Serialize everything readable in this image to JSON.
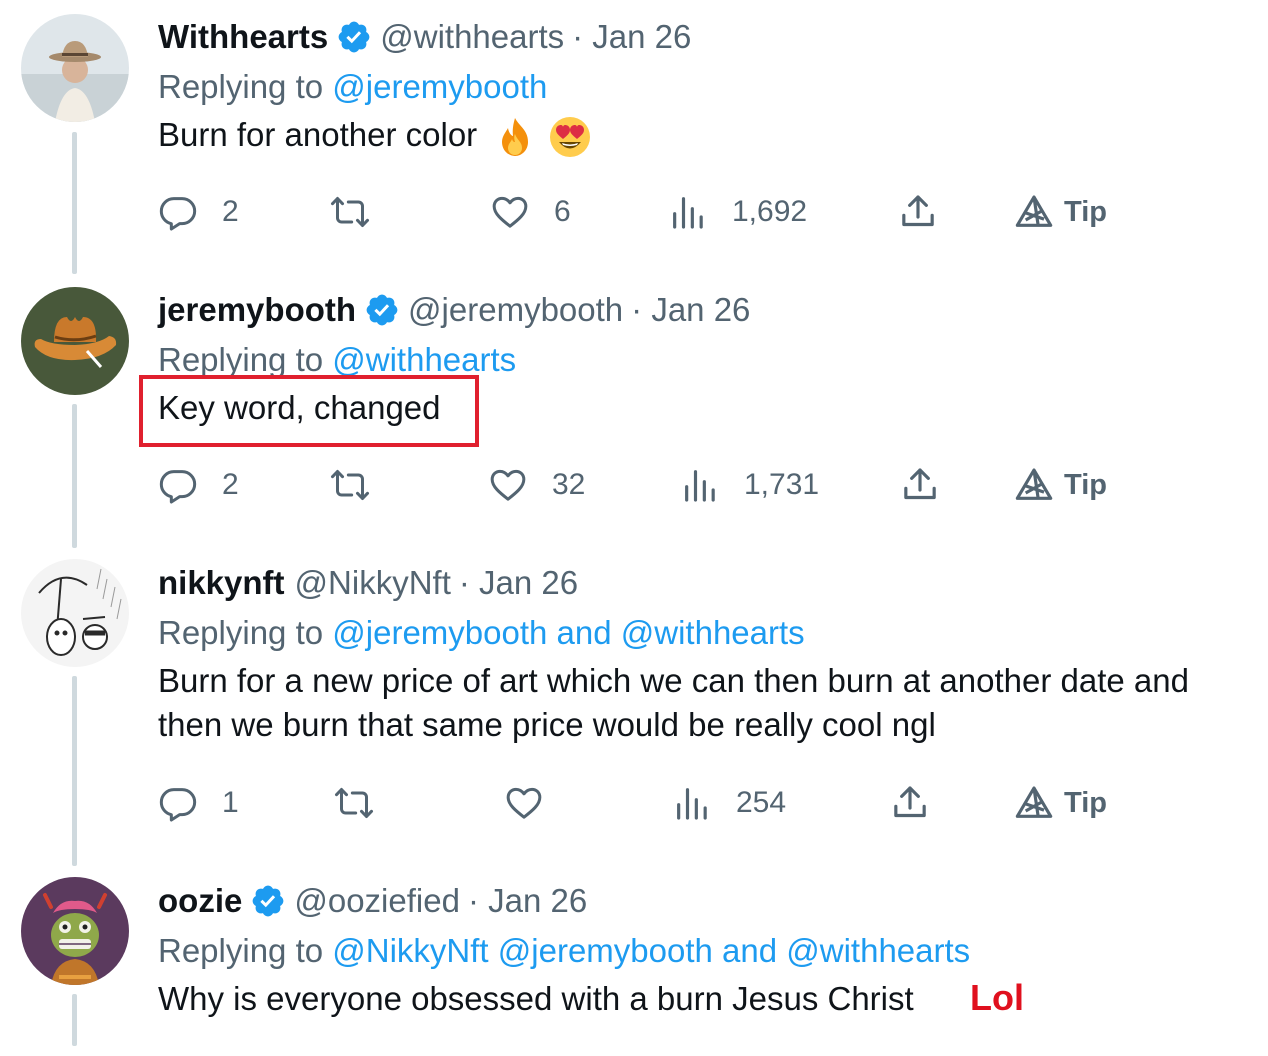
{
  "tweets": [
    {
      "name": "Withhearts",
      "verified": true,
      "handle": "@withhearts",
      "date": "· Jan 26",
      "replying_prefix": "Replying to ",
      "mentions": "@jeremybooth",
      "body": "Burn for another color",
      "emojis": [
        "fire-emoji",
        "heart-eyes-emoji"
      ],
      "replies": "2",
      "retweets": "",
      "likes": "6",
      "views": "1,692",
      "tip": "Tip"
    },
    {
      "name": "jeremybooth",
      "verified": true,
      "handle": "@jeremybooth",
      "date": "· Jan 26",
      "replying_prefix": "Replying to ",
      "mentions": "@withhearts",
      "body": "Key word, changed",
      "replies": "2",
      "retweets": "",
      "likes": "32",
      "views": "1,731",
      "tip": "Tip"
    },
    {
      "name": "nikkynft",
      "verified": false,
      "handle": "@NikkyNft",
      "date": "· Jan 26",
      "replying_prefix": "Replying to ",
      "mentions": "@jeremybooth and @withhearts",
      "body_line1": "Burn for a new price of art which we can then burn at another date and",
      "body_line2": "then we burn that same price would be really cool ngl",
      "replies": "1",
      "retweets": "",
      "likes": "",
      "views": "254",
      "tip": "Tip"
    },
    {
      "name": "oozie",
      "verified": true,
      "handle": "@ooziefied",
      "date": "· Jan 26",
      "replying_prefix": "Replying to ",
      "mentions": "@NikkyNft @jeremybooth and @withhearts",
      "body": "Why is everyone obsessed with a burn Jesus Christ"
    }
  ],
  "annotations": {
    "lol": "Lol"
  },
  "colors": {
    "link": "#1d9bf0",
    "muted": "#536471",
    "verified": "#1d9bf0",
    "highlight": "#e0202e"
  },
  "icons": [
    "reply-icon",
    "retweet-icon",
    "like-icon",
    "views-icon",
    "share-icon",
    "tip-icon",
    "verified-badge-icon"
  ]
}
